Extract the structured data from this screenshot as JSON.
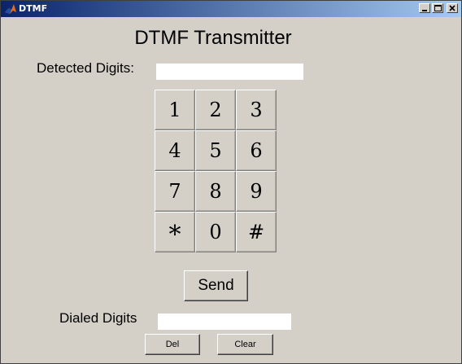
{
  "window": {
    "title": "DTMF",
    "title_gradient_start": "#0a246a",
    "title_gradient_end": "#a6caf0",
    "app_icon": "matlab-icon"
  },
  "main": {
    "heading": "DTMF Transmitter",
    "detected_label": "Detected Digits:",
    "detected_value": "",
    "dialed_label": "Dialed Digits",
    "dialed_value": ""
  },
  "keypad": {
    "keys": [
      "1",
      "2",
      "3",
      "4",
      "5",
      "6",
      "7",
      "8",
      "9",
      "*",
      "0",
      "#"
    ]
  },
  "buttons": {
    "send": "Send",
    "del": "Del",
    "clear": "Clear"
  }
}
